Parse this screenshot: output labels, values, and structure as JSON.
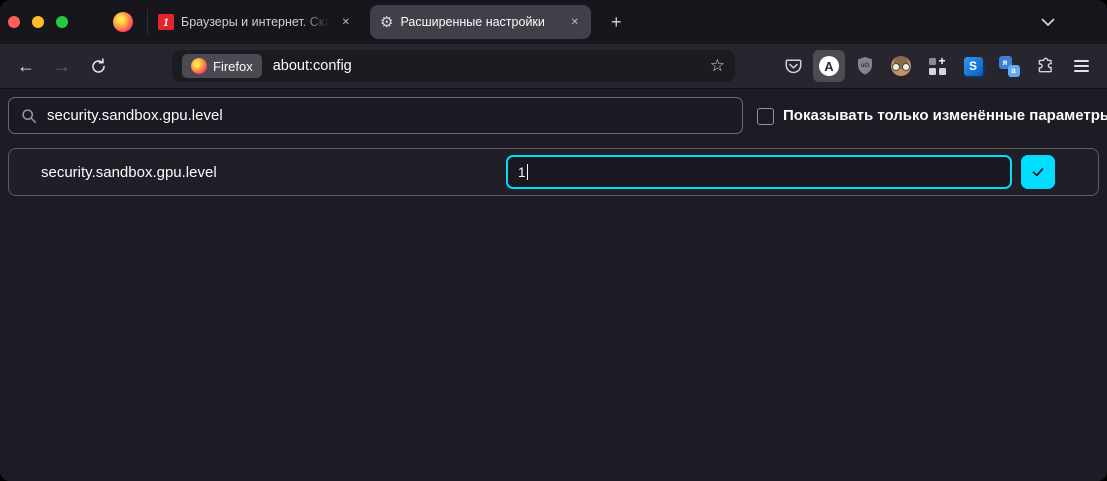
{
  "tab_bar": {
    "tabs": [
      {
        "favicon_text": "1",
        "title": "Браузеры и интернет. Скачать"
      },
      {
        "title": "Расширенные настройки",
        "active": true
      }
    ],
    "new_tab_glyph": "+",
    "close_glyph": "✕",
    "gear_glyph": "⚙"
  },
  "nav_bar": {
    "back_glyph": "←",
    "forward_glyph": "→",
    "identity_chip_label": "Firefox",
    "url": "about:config",
    "star_glyph": "☆",
    "extensions": {
      "adguard_letter": "A",
      "ublock_letters": "uO",
      "s_badge_letter": "S",
      "translate_letter_top": "я",
      "translate_letter_bottom": "a",
      "grid_plus_glyph": "+"
    }
  },
  "content": {
    "search_value": "security.sandbox.gpu.level",
    "filter_checkbox_label": "Показывать только изменённые параметры",
    "pref_row": {
      "name": "security.sandbox.gpu.level",
      "value": "1"
    }
  },
  "colors": {
    "accent_cyan": "#00ddff",
    "traffic_red": "#ff5f57",
    "traffic_yellow": "#febc2e",
    "traffic_green": "#28c840",
    "favicon_red": "#e2242d",
    "text_primary": "#fbfbfe"
  }
}
